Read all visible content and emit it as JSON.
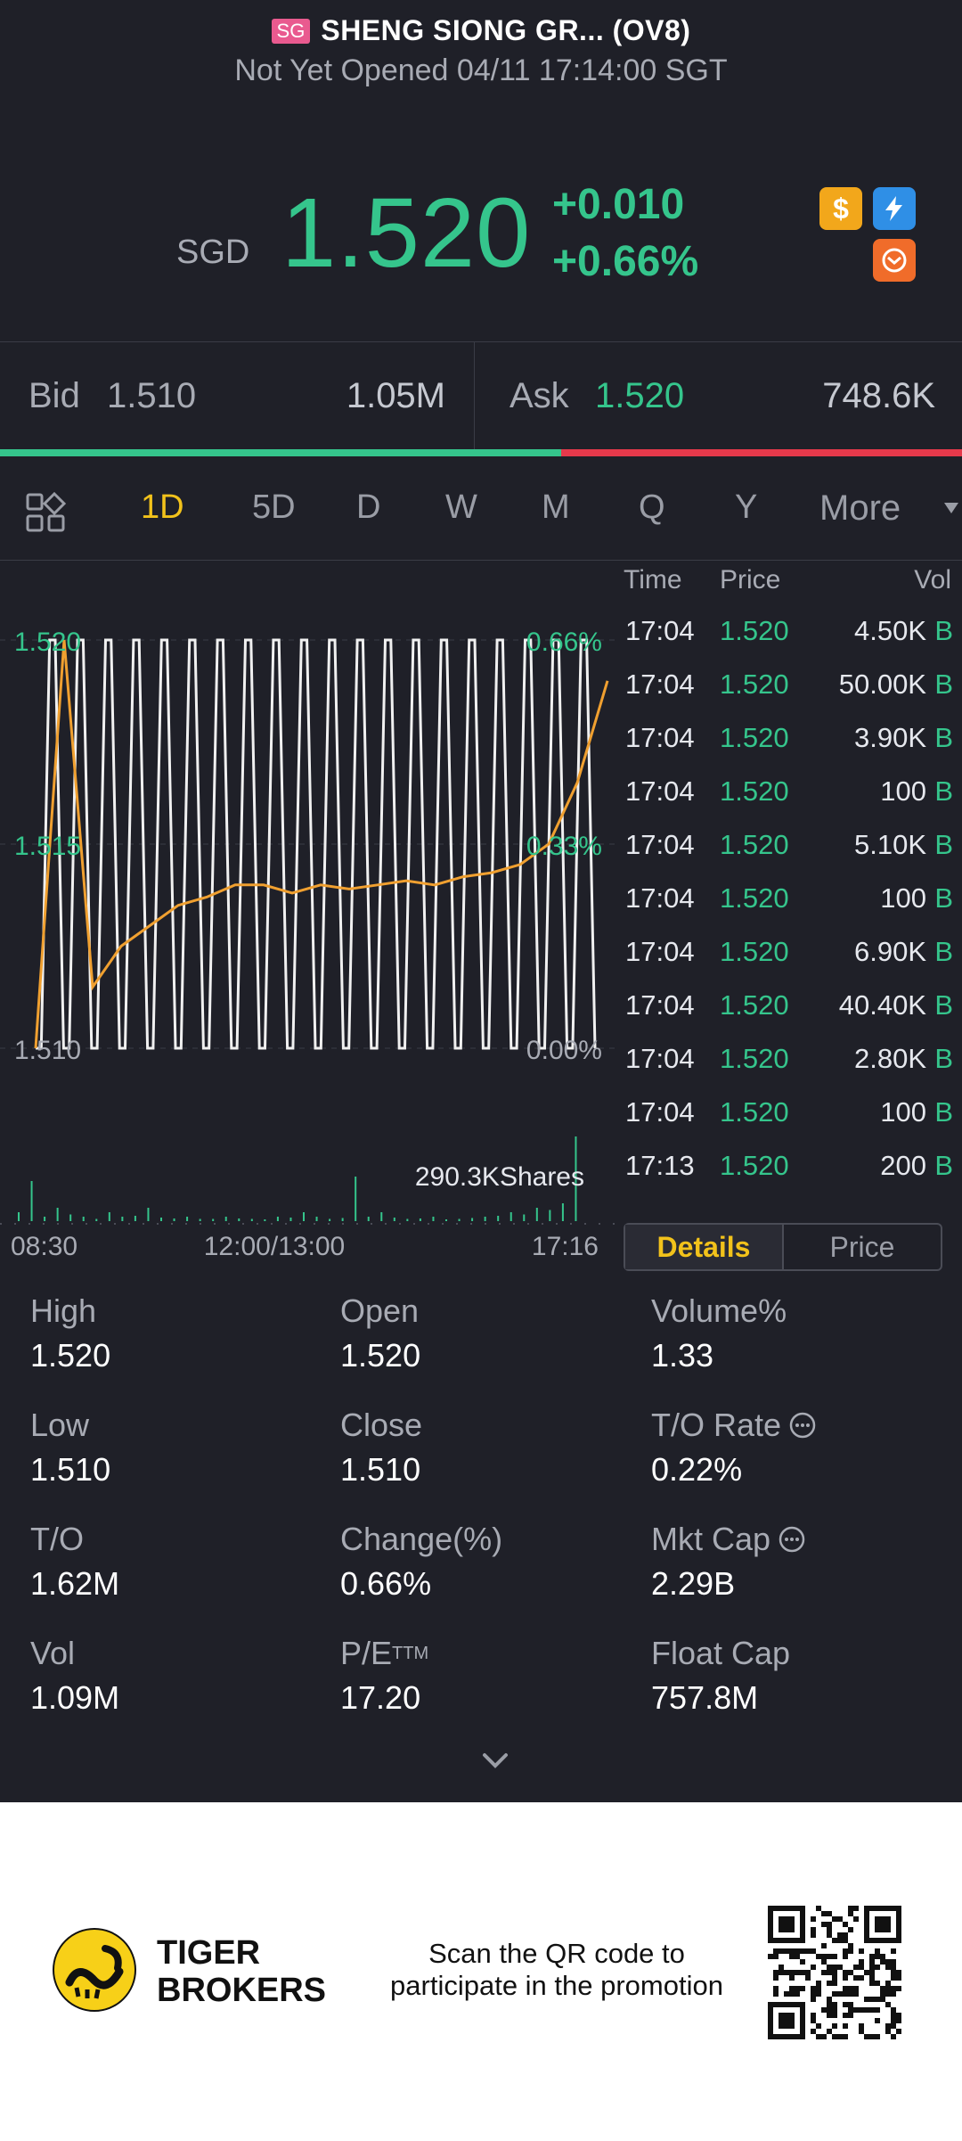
{
  "header": {
    "flag": "SG",
    "name": "SHENG SIONG GR... (OV8)",
    "status": "Not Yet Opened 04/11 17:14:00 SGT"
  },
  "quote": {
    "currency": "SGD",
    "price": "1.520",
    "change": "+0.010",
    "change_pct": "+0.66%",
    "icons": [
      "dollar-badge-icon",
      "flash-badge-icon",
      "exchange-badge-icon"
    ],
    "badge_dollar": "$"
  },
  "bidask": {
    "bid_label": "Bid",
    "bid_price": "1.510",
    "bid_size": "1.05M",
    "ask_label": "Ask",
    "ask_price": "1.520",
    "ask_size": "748.6K",
    "buy_ratio": 0.583
  },
  "tabs": [
    "1D",
    "5D",
    "D",
    "W",
    "M",
    "Q",
    "Y"
  ],
  "active_tab": "1D",
  "more_label": "More",
  "chart_data": {
    "type": "line",
    "y_left_ticks": [
      "1.520",
      "1.515",
      "1.510"
    ],
    "y_right_ticks": [
      "0.66%",
      "0.33%",
      "0.00%"
    ],
    "x_ticks": [
      "08:30",
      "12:00/13:00",
      "17:16"
    ],
    "ylim": [
      1.51,
      1.52
    ],
    "volume_label": "290.3KShares",
    "series": [
      {
        "values": [
          1.51,
          1.52,
          1.51,
          1.52,
          1.51,
          1.52,
          1.51,
          1.52,
          1.51,
          1.52,
          1.51,
          1.52,
          1.51,
          1.52,
          1.51,
          1.52,
          1.51,
          1.52,
          1.51,
          1.52,
          1.51,
          1.52,
          1.51,
          1.52,
          1.51,
          1.52,
          1.51,
          1.52,
          1.51,
          1.52,
          1.51,
          1.52,
          1.51,
          1.52,
          1.51,
          1.52,
          1.51,
          1.52,
          1.51,
          1.52,
          1.51
        ]
      },
      {
        "values": [
          1.51,
          1.52,
          1.5115,
          1.5125,
          1.513,
          1.5135,
          1.5137,
          1.514,
          1.514,
          1.5138,
          1.514,
          1.5139,
          1.514,
          1.5141,
          1.514,
          1.5142,
          1.5143,
          1.5145,
          1.515,
          1.5165
        ]
      }
    ],
    "colors": {
      "price_line": "#f0f0f0",
      "avg_line": "#f0a030",
      "volume": "#35c58c"
    }
  },
  "tape": {
    "headers": {
      "time": "Time",
      "price": "Price",
      "vol": "Vol"
    },
    "rows": [
      {
        "time": "17:04",
        "price": "1.520",
        "vol": "4.50K",
        "side": "B"
      },
      {
        "time": "17:04",
        "price": "1.520",
        "vol": "50.00K",
        "side": "B"
      },
      {
        "time": "17:04",
        "price": "1.520",
        "vol": "3.90K",
        "side": "B"
      },
      {
        "time": "17:04",
        "price": "1.520",
        "vol": "100",
        "side": "B"
      },
      {
        "time": "17:04",
        "price": "1.520",
        "vol": "5.10K",
        "side": "B"
      },
      {
        "time": "17:04",
        "price": "1.520",
        "vol": "100",
        "side": "B"
      },
      {
        "time": "17:04",
        "price": "1.520",
        "vol": "6.90K",
        "side": "B"
      },
      {
        "time": "17:04",
        "price": "1.520",
        "vol": "40.40K",
        "side": "B"
      },
      {
        "time": "17:04",
        "price": "1.520",
        "vol": "2.80K",
        "side": "B"
      },
      {
        "time": "17:04",
        "price": "1.520",
        "vol": "100",
        "side": "B"
      },
      {
        "time": "17:13",
        "price": "1.520",
        "vol": "200",
        "side": "B"
      }
    ]
  },
  "toggle": {
    "details": "Details",
    "price": "Price"
  },
  "stats": [
    {
      "label": "High",
      "value": "1.520"
    },
    {
      "label": "Open",
      "value": "1.520"
    },
    {
      "label": "Volume%",
      "value": "1.33"
    },
    {
      "label": "Low",
      "value": "1.510"
    },
    {
      "label": "Close",
      "value": "1.510"
    },
    {
      "label": "T/O Rate",
      "value": "0.22%",
      "info": true
    },
    {
      "label": "T/O",
      "value": "1.62M"
    },
    {
      "label": "Change(%)",
      "value": "0.66%"
    },
    {
      "label": "Mkt Cap",
      "value": "2.29B",
      "info": true
    },
    {
      "label": "Vol",
      "value": "1.09M"
    },
    {
      "label": "P/E",
      "label_sup": "TTM",
      "value": "17.20"
    },
    {
      "label": "Float Cap",
      "value": "757.8M"
    }
  ],
  "promo": {
    "brand_line1": "TIGER",
    "brand_line2": "BROKERS",
    "text_line1": "Scan the QR code to",
    "text_line2": "participate in the promotion"
  }
}
